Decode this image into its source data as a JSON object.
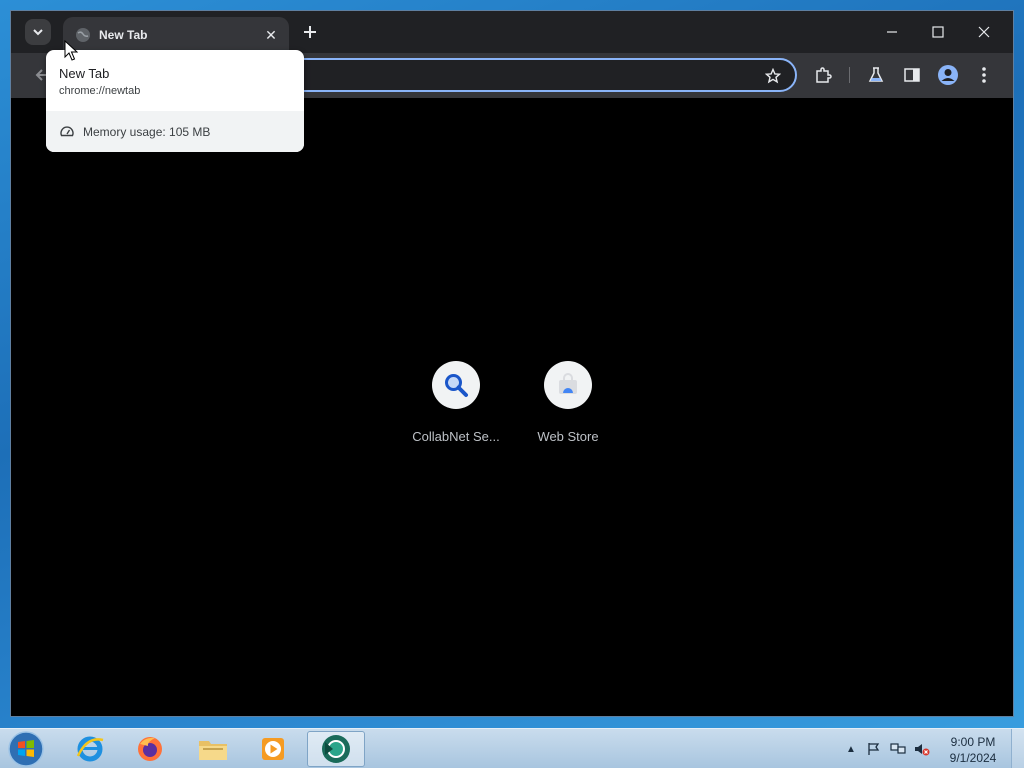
{
  "browser": {
    "tab": {
      "title": "New Tab",
      "close_icon": "close-icon"
    },
    "hovercard": {
      "title": "New Tab",
      "url": "chrome://newtab",
      "memory": "Memory usage: 105 MB"
    },
    "shortcuts": [
      {
        "label": "CollabNet Se...",
        "icon": "search-icon"
      },
      {
        "label": "Web Store",
        "icon": "web-store-icon"
      }
    ],
    "colors": {
      "accent": "#8ab4f8",
      "frame": "#202124",
      "toolbar": "#35363a",
      "page": "#000000"
    }
  },
  "taskbar": {
    "apps": [
      {
        "name": "Internet Explorer",
        "icon": "ie-icon"
      },
      {
        "name": "Firefox",
        "icon": "firefox-icon"
      },
      {
        "name": "File Explorer",
        "icon": "folder-icon"
      },
      {
        "name": "Media Player",
        "icon": "media-player-icon"
      },
      {
        "name": "Chrome",
        "icon": "chrome-icon"
      }
    ],
    "clock": {
      "time": "9:00 PM",
      "date": "9/1/2024"
    }
  }
}
